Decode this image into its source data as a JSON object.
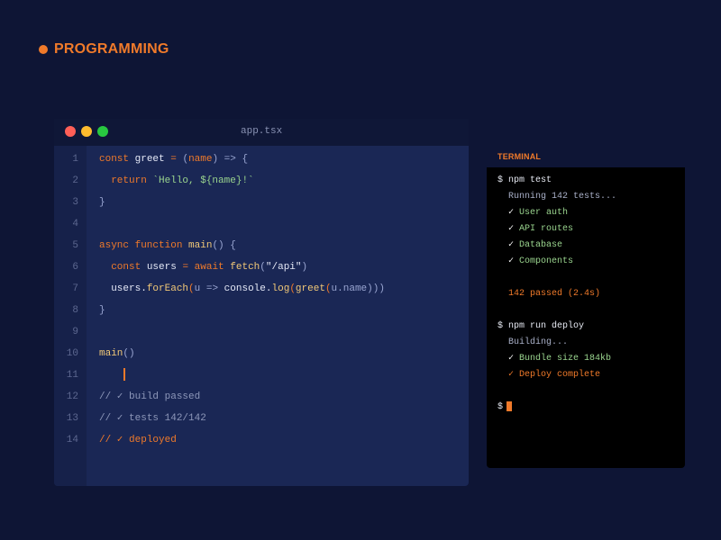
{
  "header": {
    "title": "PROGRAMMING"
  },
  "editor": {
    "filename": "app.tsx",
    "line_numbers": [
      "1",
      "2",
      "3",
      "4",
      "5",
      "6",
      "7",
      "8",
      "9",
      "10",
      "11",
      "12",
      "13",
      "14"
    ]
  },
  "code": {
    "l1": {
      "kw": "const",
      "name": "greet",
      "eq": " = ",
      "po": "(",
      "param": "name",
      "pc": ")",
      "arrow": " => ",
      "brace": "{"
    },
    "l2": {
      "kw": "return",
      "str": "`Hello, ${name}!`"
    },
    "l3": {
      "brace": "}"
    },
    "l5": {
      "kw": "async function",
      "name": "main",
      "rest": "() {"
    },
    "l6": {
      "kw": "const",
      "name": "users",
      "eq": " = ",
      "aw": "await",
      "fn": "fetch",
      "po": "(",
      "str": "\"/api\"",
      "pc": ")"
    },
    "l7": {
      "obj": "users",
      "dot": ".",
      "m1": "forEach",
      "p1": "(",
      "u": "u",
      "arrow": " => ",
      "cons": "console",
      "dot2": ".",
      "m2": "log",
      "p2": "(",
      "m3": "greet",
      "p3": "(",
      "arg": "u.name",
      "close": ")))"
    },
    "l8": {
      "brace": "}"
    },
    "l10": {
      "fn": "main",
      "rest": "()"
    },
    "l12": {
      "text": "// ✓ build passed"
    },
    "l13": {
      "text": "// ✓ tests 142/142"
    },
    "l14": {
      "text": "// ✓ deployed"
    }
  },
  "terminal": {
    "title": "TERMINAL",
    "cmd1": "$ npm test",
    "running": "  Running 142 tests...",
    "checks1": [
      {
        "mark": "  ✓ ",
        "label": "User auth"
      },
      {
        "mark": "  ✓ ",
        "label": "API routes"
      },
      {
        "mark": "  ✓ ",
        "label": "Database"
      },
      {
        "mark": "  ✓ ",
        "label": "Components"
      }
    ],
    "passed": "  142 passed (2.4s)",
    "cmd2": "$ npm run deploy",
    "building": "  Building...",
    "bundle_mark": "  ✓ ",
    "bundle": "Bundle size 184kb",
    "deploy": "  ✓ Deploy complete",
    "prompt": "$"
  },
  "colors": {
    "background": "#0e1535",
    "accent": "#f07a2a",
    "editor_bg": "#1a2755",
    "terminal_bg": "#000000",
    "success": "#9ad48e"
  }
}
